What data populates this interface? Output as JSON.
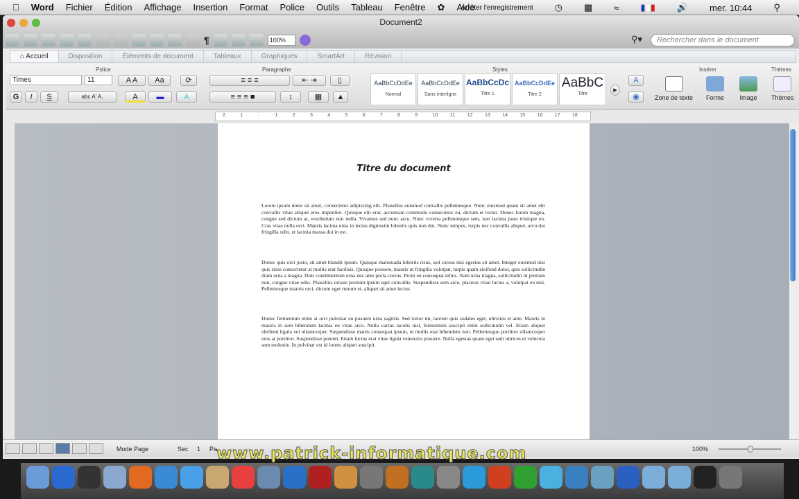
{
  "menubar": {
    "items": [
      "Word",
      "Fichier",
      "Édition",
      "Affichage",
      "Insertion",
      "Format",
      "Police",
      "Outils",
      "Tableau",
      "Fenêtre",
      "Aide"
    ],
    "record": "Arrêter l'enregistrement",
    "clock": "mer. 10:44"
  },
  "window": {
    "title": "Document2",
    "zoom": "100%",
    "search_placeholder": "Rechercher dans le document"
  },
  "tabs": [
    "Accueil",
    "Disposition",
    "Éléments de document",
    "Tableaux",
    "Graphiques",
    "SmartArt",
    "Révision"
  ],
  "ribbon": {
    "groups": {
      "font": "Police",
      "paragraph": "Paragraphe",
      "styles": "Styles",
      "insert": "Insérer",
      "themes": "Thèmes"
    },
    "font_name": "Times",
    "font_size": "11",
    "styles": [
      {
        "sample": "AaBbCcDdEe",
        "label": "Normal"
      },
      {
        "sample": "AaBbCcDdEe",
        "label": "Sans interligne"
      },
      {
        "sample": "AaBbCcDc",
        "label": "Titre 1"
      },
      {
        "sample": "AaBbCcDdEe",
        "label": "Titre 2"
      },
      {
        "sample": "AaBbC",
        "label": "Titre"
      }
    ],
    "insert": [
      "Zone de texte",
      "Forme",
      "Image"
    ],
    "themes": "Thèmes"
  },
  "ruler": [
    "2",
    "1",
    "",
    "1",
    "2",
    "3",
    "4",
    "5",
    "6",
    "7",
    "8",
    "9",
    "10",
    "11",
    "12",
    "13",
    "14",
    "15",
    "16",
    "17",
    "18"
  ],
  "document": {
    "title": "Titre du document",
    "paragraphs": [
      "Lorem ipsum dolor sit amet, consectetur adipiscing elit. Phasellus euismod convallis pellentesque. Nunc euismod quam sit amet elit convallis vitae aliquet eros imperdiet. Quisque elit erat, accumsan commodo consectetur eu, dictum et tortor. Donec lorem magna, congue sed dictum at, vestibulum non nulla. Vivamus sed nunc arcu. Nunc viverra pellentesque sem, non lacinia justo tristique eu. Cras vitae nulla orci. Mauris lacinia urna in lectus dignissim lobortis quis non dui. Nunc tempus, turpis nec convallis aliquet, arcu dui fringilla odio, et lacinia massa dui in est.",
      "Donec quis orci justo, sit amet blandit ipsum. Quisque malesuada lobortis risus, sed cursus nisi egestas sit amet. Integer euismod nisi quis risus consectetur at mollis erat facilisis. Quisque posuere, mauris ut fringilla volutpat, turpis quam eleifend dolor, quis sollicitudin diam urna a magna. Duis condimentum urna nec ante porta cursus. Proin eu consequat tellus. Nam urna magna, sollicitudin id pretium non, congue vitae odio. Phasellus ornare pretium ipsum eget convallis. Suspendisse sem arcu, placerat vitae luctus a, volutpat eu nisi. Pellentesque mauris orci, dictum eget rutrum et, aliquet sit amet lectus.",
      "Donec fermentum enim at orci pulvinar eu posuere urna sagittis. Sed tortor mi, laoreet quis sodales eget, ultricies et ante. Mauris in mauris in sem bibendum lacinia eu vitae arcu. Nulla varius iaculis nisl, fermentum suscipit enim sollicitudin vel. Etiam aliquet eleifend ligula vel ullamcorper. Suspendisse mattis consequat ipsum, ut mollis erat bibendum non. Pellentesque porttitor ullamcorper eros at porttitor. Suspendisse potenti. Etiam luctus erat vitae ligula venenatis posuere. Nulla egestas quam eget sem ultrices et vehicula sem molestie. In pulvinar est id lorem aliquet suscipit."
    ]
  },
  "status": {
    "mode": "Mode Page",
    "section_label": "Sec",
    "section": "1",
    "page_label": "Pa",
    "zoom": "100%"
  },
  "watermark": "www.patrick-informatique.com",
  "dock": [
    "finder",
    "app-store",
    "dashboard",
    "mail",
    "firefox",
    "safari",
    "ichat",
    "address-book",
    "ical",
    "iphoto",
    "itunes",
    "photo-booth",
    "iphoto-2",
    "imovie",
    "garageband",
    "time-machine",
    "system-preferences",
    "word",
    "powerpoint",
    "excel",
    "messenger",
    "download",
    "preview",
    "quicktime",
    "applications-folder",
    "documents-folder",
    "music",
    "trash"
  ],
  "colors": {
    "dock_bg": "#3a3a3a",
    "page": "#ffffff",
    "workspace": "#aeb4bd",
    "accent": "#3a7cc8"
  }
}
